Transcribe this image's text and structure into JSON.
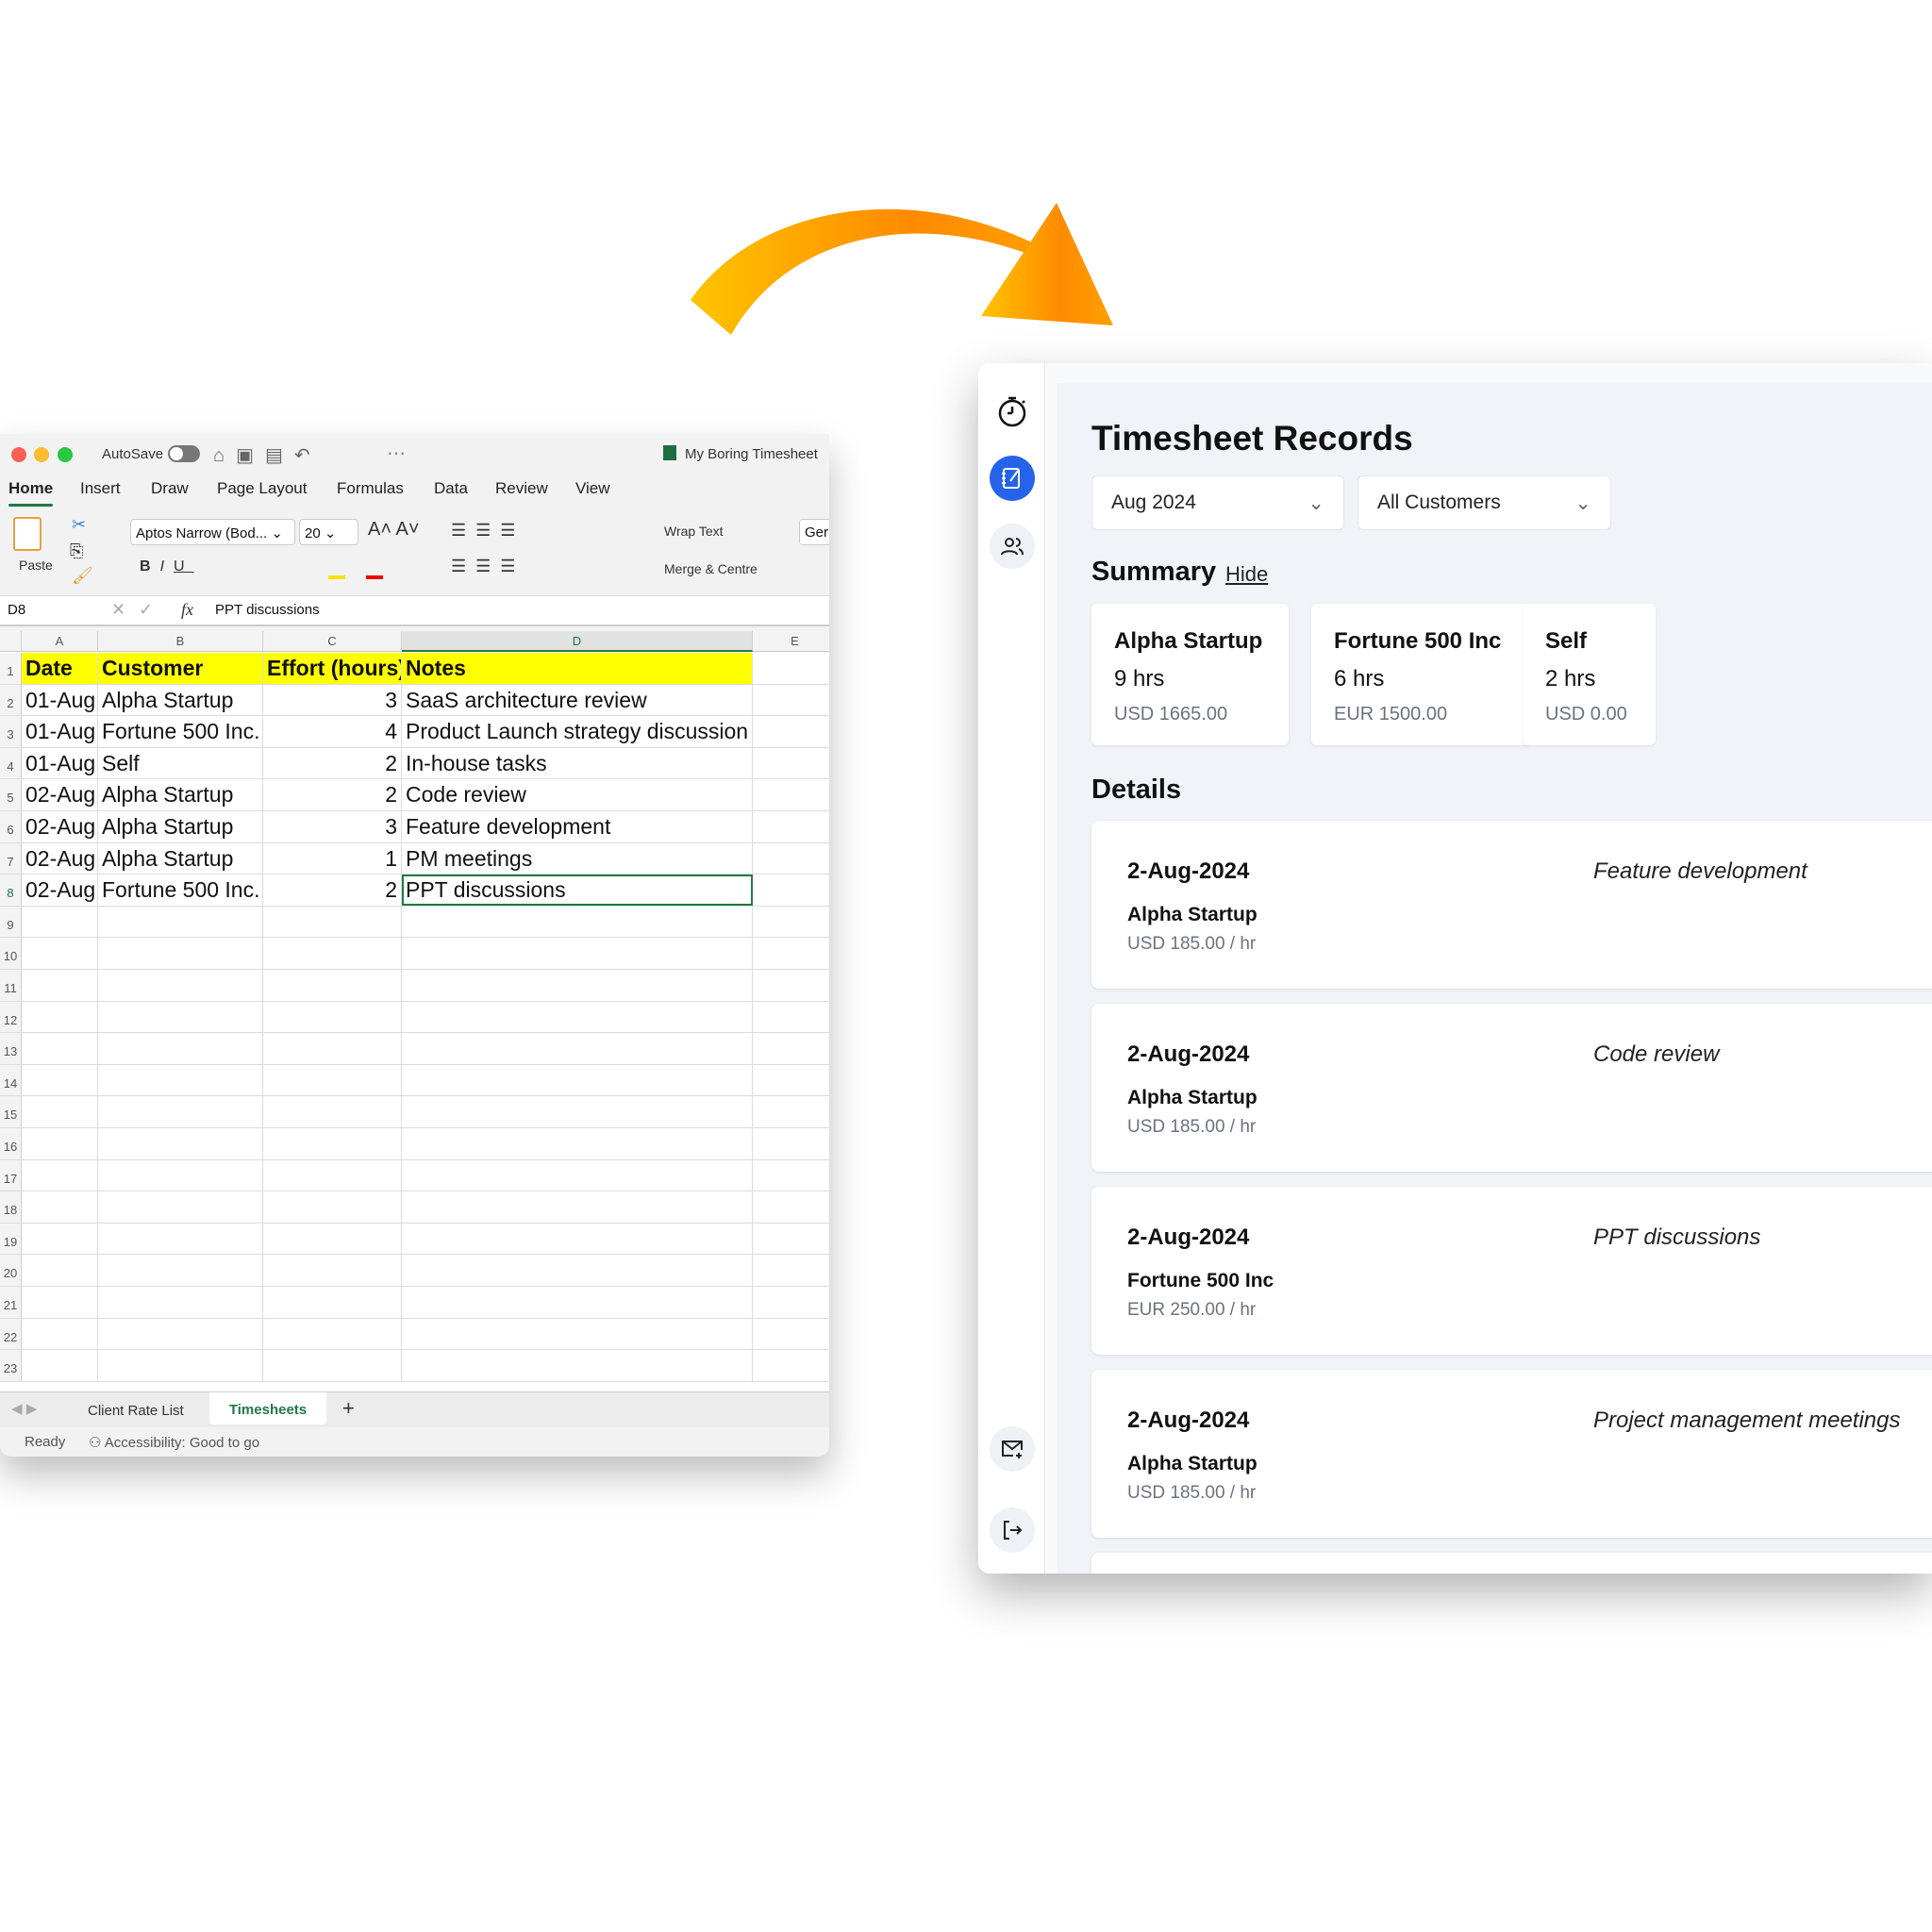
{
  "excel": {
    "autosave_label": "AutoSave",
    "title": "My Boring Timesheet",
    "tabs": [
      "Home",
      "Insert",
      "Draw",
      "Page Layout",
      "Formulas",
      "Data",
      "Review",
      "View"
    ],
    "active_tab": "Home",
    "paste_label": "Paste",
    "font_name": "Aptos Narrow (Bod...",
    "font_size": "20",
    "wrap_text": "Wrap Text",
    "merge_centre": "Merge & Centre",
    "number_format": "Ger",
    "name_box": "D8",
    "formula": "PPT discussions",
    "columns": [
      "A",
      "B",
      "C",
      "D",
      "E"
    ],
    "rows": [
      [
        "Date",
        "Customer",
        "Effort (hours)",
        "Notes"
      ],
      [
        "01-Aug",
        "Alpha Startup",
        "3",
        "SaaS architecture review"
      ],
      [
        "01-Aug",
        "Fortune 500 Inc.",
        "4",
        "Product Launch strategy discussion"
      ],
      [
        "01-Aug",
        "Self",
        "2",
        "In-house tasks"
      ],
      [
        "02-Aug",
        "Alpha Startup",
        "2",
        "Code review"
      ],
      [
        "02-Aug",
        "Alpha Startup",
        "3",
        "Feature development"
      ],
      [
        "02-Aug",
        "Alpha Startup",
        "1",
        "PM meetings"
      ],
      [
        "02-Aug",
        "Fortune 500 Inc.",
        "2",
        "PPT discussions"
      ]
    ],
    "row_numbers": [
      "1",
      "2",
      "3",
      "4",
      "5",
      "6",
      "7",
      "8",
      "9",
      "10",
      "11",
      "12",
      "13",
      "14",
      "15",
      "16",
      "17",
      "18",
      "19",
      "20",
      "21",
      "22",
      "23"
    ],
    "header_fill": "#ffff00",
    "sheets": [
      "Client Rate List",
      "Timesheets"
    ],
    "active_sheet": "Timesheets",
    "status": "Ready",
    "accessibility": "Accessibility: Good to go"
  },
  "app": {
    "title": "Timesheet Records",
    "month_filter": "Aug 2024",
    "customer_filter": "All Customers",
    "summary_label": "Summary",
    "hide_label": "Hide",
    "summary": [
      {
        "name": "Alpha Startup",
        "hours": "9 hrs",
        "amount": "USD 1665.00"
      },
      {
        "name": "Fortune 500 Inc",
        "hours": "6 hrs",
        "amount": "EUR 1500.00"
      },
      {
        "name": "Self",
        "hours": "2 hrs",
        "amount": "USD 0.00"
      }
    ],
    "details_label": "Details",
    "details": [
      {
        "date": "2-Aug-2024",
        "customer": "Alpha Startup",
        "rate": "USD 185.00 / hr",
        "note": "Feature development"
      },
      {
        "date": "2-Aug-2024",
        "customer": "Alpha Startup",
        "rate": "USD 185.00 / hr",
        "note": "Code review"
      },
      {
        "date": "2-Aug-2024",
        "customer": "Fortune 500 Inc",
        "rate": "EUR 250.00 / hr",
        "note": "PPT discussions"
      },
      {
        "date": "2-Aug-2024",
        "customer": "Alpha Startup",
        "rate": "USD 185.00 / hr",
        "note": "Project management meetings"
      }
    ],
    "accent": "#2563eb"
  }
}
